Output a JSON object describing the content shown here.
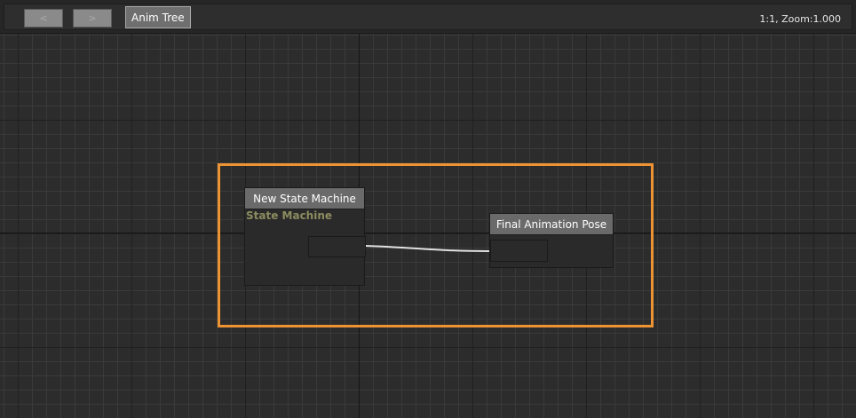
{
  "toolbar": {
    "back_label": "<",
    "forward_label": ">",
    "breadcrumb": "Anim Tree",
    "zoom_text": "1:1, Zoom:1.000"
  },
  "graph": {
    "nodes": [
      {
        "title": "New State Machine",
        "subtitle": "State Machine"
      },
      {
        "title": "Final Animation Pose"
      }
    ]
  },
  "colors": {
    "background": "#2c2c2c",
    "selection": "#ee9333",
    "node_header": "#6a6a6a",
    "node_subtitle": "#8c8c60",
    "wire": "#e0e0e0"
  }
}
